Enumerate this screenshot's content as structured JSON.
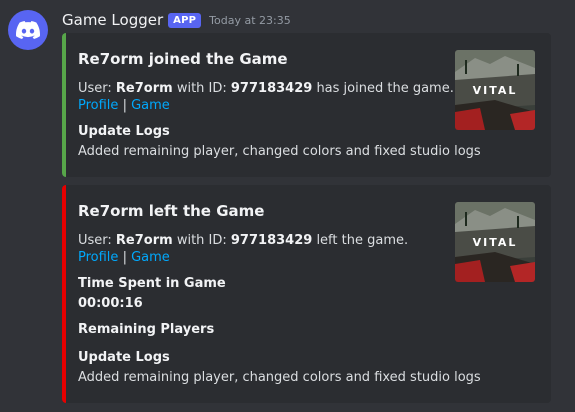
{
  "message": {
    "author": "Game Logger",
    "badge": "APP",
    "timestamp": "Today at 23:35",
    "avatar_icon": "discord-logo-icon"
  },
  "embeds": [
    {
      "color": "#57a64a",
      "title": "Re7orm joined the Game",
      "desc_user_label": "User: ",
      "username": "Re7orm",
      "desc_id_label": " with ID: ",
      "user_id": "977183429",
      "desc_suffix": " has joined the game.",
      "link_profile": "Profile",
      "link_separator": "|",
      "link_game": "Game",
      "thumbnail_text": "VITAL",
      "fields": [
        {
          "name": "Update Logs",
          "value": "Added remaining player, changed colors and fixed studio logs"
        }
      ]
    },
    {
      "color": "#e60000",
      "title": "Re7orm left the Game",
      "desc_user_label": "User: ",
      "username": "Re7orm",
      "desc_id_label": " with ID: ",
      "user_id": "977183429",
      "desc_suffix": " left the game.",
      "link_profile": "Profile",
      "link_separator": "|",
      "link_game": "Game",
      "thumbnail_text": "VITAL",
      "fields": [
        {
          "name": "Time Spent in Game",
          "value": "00:00:16"
        },
        {
          "name": "Remaining Players",
          "value": ""
        },
        {
          "name": "Update Logs",
          "value": "Added remaining player, changed colors and fixed studio logs"
        }
      ]
    }
  ]
}
